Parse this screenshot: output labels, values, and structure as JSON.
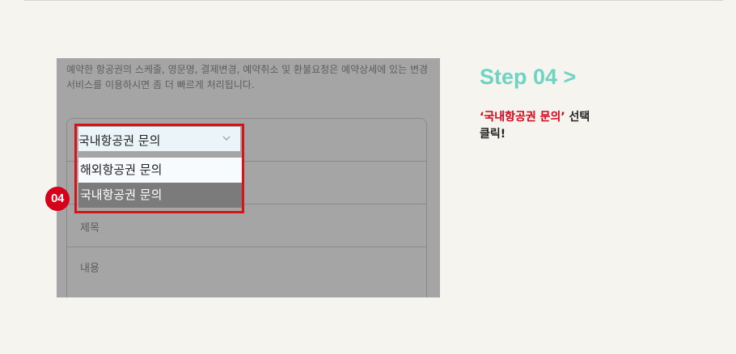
{
  "screenshot": {
    "description": "예약한 항공권의 스케줄, 영문명, 결제변경, 예약취소 및 환불요청은 예약상세에 있는 변경서비스를 이용하시면 좀 더 빠르게 처리됩니다.",
    "select": {
      "current_value": "국내항공권 문의",
      "icon": "chevron-down-icon",
      "options": [
        "해외항공권 문의",
        "국내항공권 문의"
      ],
      "highlighted_option": "국내항공권 문의"
    },
    "fields": {
      "title_label": "제목",
      "content_label": "내용"
    },
    "step_badge": "04"
  },
  "instruction": {
    "title": "Step 04 >",
    "quoted_label": "‘국내항공권 문의’",
    "action_suffix": "선택",
    "action_line2": "클릭!"
  },
  "colors": {
    "accent_teal": "#6fd3c2",
    "accent_red": "#d7001a",
    "overlay_gray": "#a5a5a5",
    "page_background": "#f5f4ef"
  }
}
